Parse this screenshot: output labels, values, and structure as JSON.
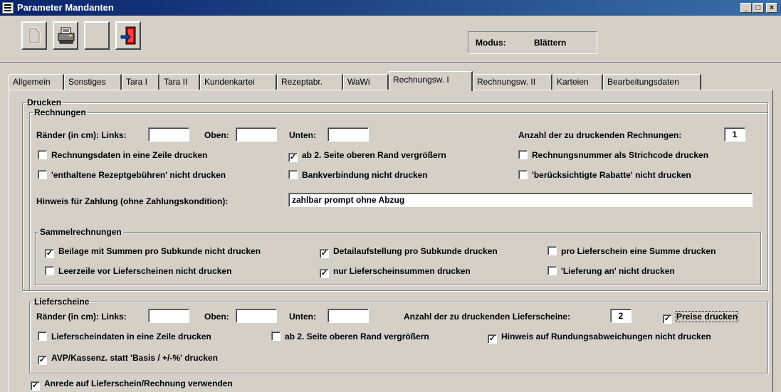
{
  "window": {
    "title": "Parameter Mandanten",
    "minimize": "_",
    "maximize": "□",
    "close": "×"
  },
  "toolbar": {
    "modus_label": "Modus:",
    "modus_value": "Blättern",
    "icons": [
      "new-document-icon",
      "printer-icon",
      "blank-icon",
      "exit-door-icon"
    ]
  },
  "tabs": [
    {
      "label": "Allgemein"
    },
    {
      "label": "Sonstiges"
    },
    {
      "label": "Tara I"
    },
    {
      "label": "Tara II"
    },
    {
      "label": "Kundenkartei"
    },
    {
      "label": "Rezeptabr."
    },
    {
      "label": "WaWi"
    },
    {
      "label": "Rechnungsw. I",
      "active": true
    },
    {
      "label": "Rechnungsw. II"
    },
    {
      "label": "Karteien"
    },
    {
      "label": "Bearbeitungsdaten"
    }
  ],
  "drucken": {
    "legend": "Drucken",
    "rechnungen": {
      "legend": "Rechnungen",
      "raender_label": "Ränder (in cm): Links:",
      "links_value": "",
      "oben_label": "Oben:",
      "oben_value": "",
      "unten_label": "Unten:",
      "unten_value": "",
      "anzahl_label": "Anzahl der zu druckenden Rechnungen:",
      "anzahl_value": "1",
      "checkboxes": [
        {
          "label": "Rechnungsdaten in eine Zeile drucken",
          "checked": ""
        },
        {
          "label": "ab 2. Seite oberen Rand vergrößern",
          "checked": "✓"
        },
        {
          "label": "Rechnungsnummer als Strichcode drucken",
          "checked": ""
        },
        {
          "label": "'enthaltene Rezeptgebühren' nicht drucken",
          "checked": ""
        },
        {
          "label": "Bankverbindung nicht drucken",
          "checked": ""
        },
        {
          "label": "'berücksichtigte Rabatte' nicht drucken",
          "checked": ""
        }
      ],
      "hinweis_label": "Hinweis für Zahlung (ohne Zahlungskondition):",
      "hinweis_value": "zahlbar prompt ohne Abzug"
    },
    "sammel": {
      "legend": "Sammelrechnungen",
      "checkboxes": [
        {
          "label": "Beilage mit Summen pro Subkunde nicht drucken",
          "checked": "✓"
        },
        {
          "label": "Detailaufstellung pro Subkunde drucken",
          "checked": "✓"
        },
        {
          "label": "pro Lieferschein eine Summe drucken",
          "checked": ""
        },
        {
          "label": "Leerzeile vor Lieferscheinen nicht drucken",
          "checked": ""
        },
        {
          "label": "nur Lieferscheinsummen drucken",
          "checked": "✓"
        },
        {
          "label": "'Lieferung an' nicht drucken",
          "checked": ""
        }
      ]
    },
    "lieferscheine": {
      "legend": "Lieferscheine",
      "raender_label": "Ränder (in cm): Links:",
      "links_value": "",
      "oben_label": "Oben:",
      "oben_value": "",
      "unten_label": "Unten:",
      "unten_value": "",
      "anzahl_label": "Anzahl der zu druckenden Lieferscheine:",
      "anzahl_value": "2",
      "checkboxes": [
        {
          "label": "Preise drucken",
          "checked": "✓"
        },
        {
          "label": "Lieferscheindaten in eine Zeile drucken",
          "checked": ""
        },
        {
          "label": "ab 2. Seite oberen Rand vergrößern",
          "checked": ""
        },
        {
          "label": "Hinweis auf Rundungsabweichungen nicht drucken",
          "checked": "✓"
        },
        {
          "label": "AVP/Kassenz. statt 'Basis / +/-%' drucken",
          "checked": "✓"
        }
      ]
    },
    "anrede": {
      "label": "Anrede auf Lieferschein/Rechnung verwenden",
      "checked": "✓"
    }
  }
}
